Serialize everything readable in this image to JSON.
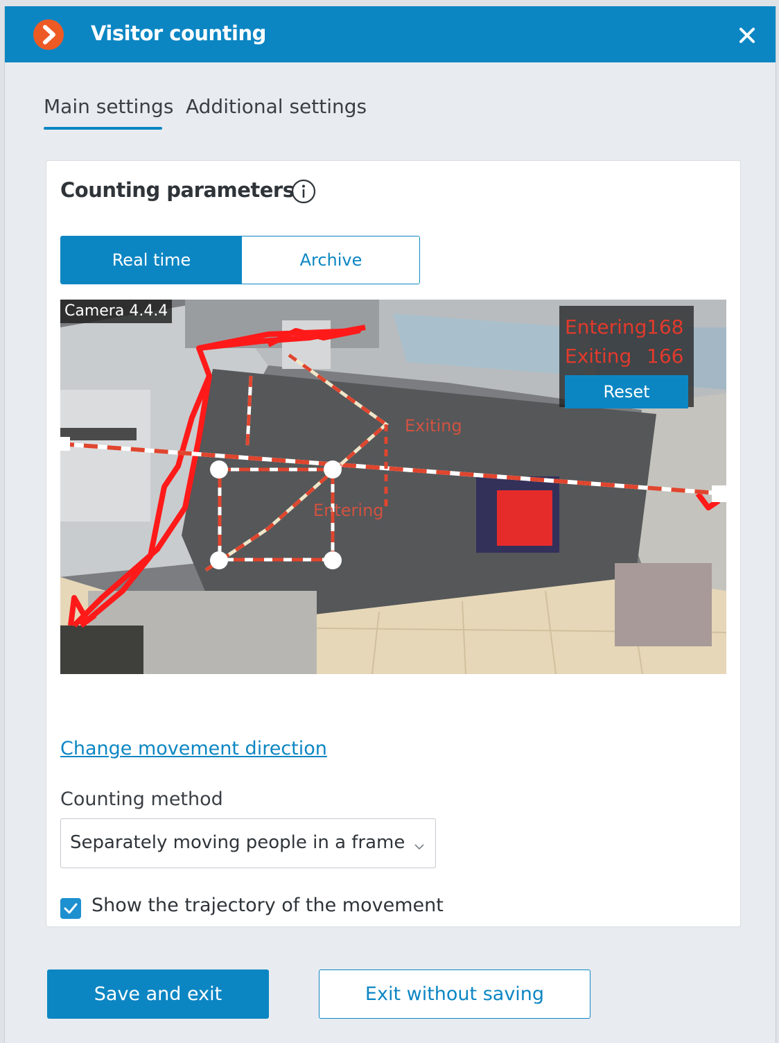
{
  "window": {
    "title": "Visitor counting",
    "icons": {
      "app": "app-logo-icon",
      "close": "close-icon"
    }
  },
  "tabs": [
    {
      "label": "Main settings",
      "active": true
    },
    {
      "label": "Additional settings",
      "active": false
    }
  ],
  "counting_parameters": {
    "title": "Counting parameters",
    "info_icon": "info-icon",
    "mode_toggle": [
      {
        "label": "Real time",
        "selected": true
      },
      {
        "label": "Archive",
        "selected": false
      }
    ],
    "video": {
      "camera_label": "Camera 4.4.4",
      "entering_label": "Entering",
      "entering_count": "168",
      "exiting_label": "Exiting",
      "exiting_count": "166",
      "reset_label": "Reset",
      "zone_label_exiting": "Exiting",
      "zone_label_entering": "Entering"
    },
    "change_direction_link": "Change movement direction",
    "counting_method": {
      "label": "Counting method",
      "value": "Separately moving people in a frame"
    },
    "show_trajectory": {
      "label": "Show the trajectory of the movement",
      "checked": true
    }
  },
  "footer": {
    "save_label": "Save and exit",
    "exit_label": "Exit without saving"
  },
  "colors": {
    "accent": "#0c86c3",
    "overlay_red": "#e23a2c",
    "app_icon": "#ee5a24"
  }
}
